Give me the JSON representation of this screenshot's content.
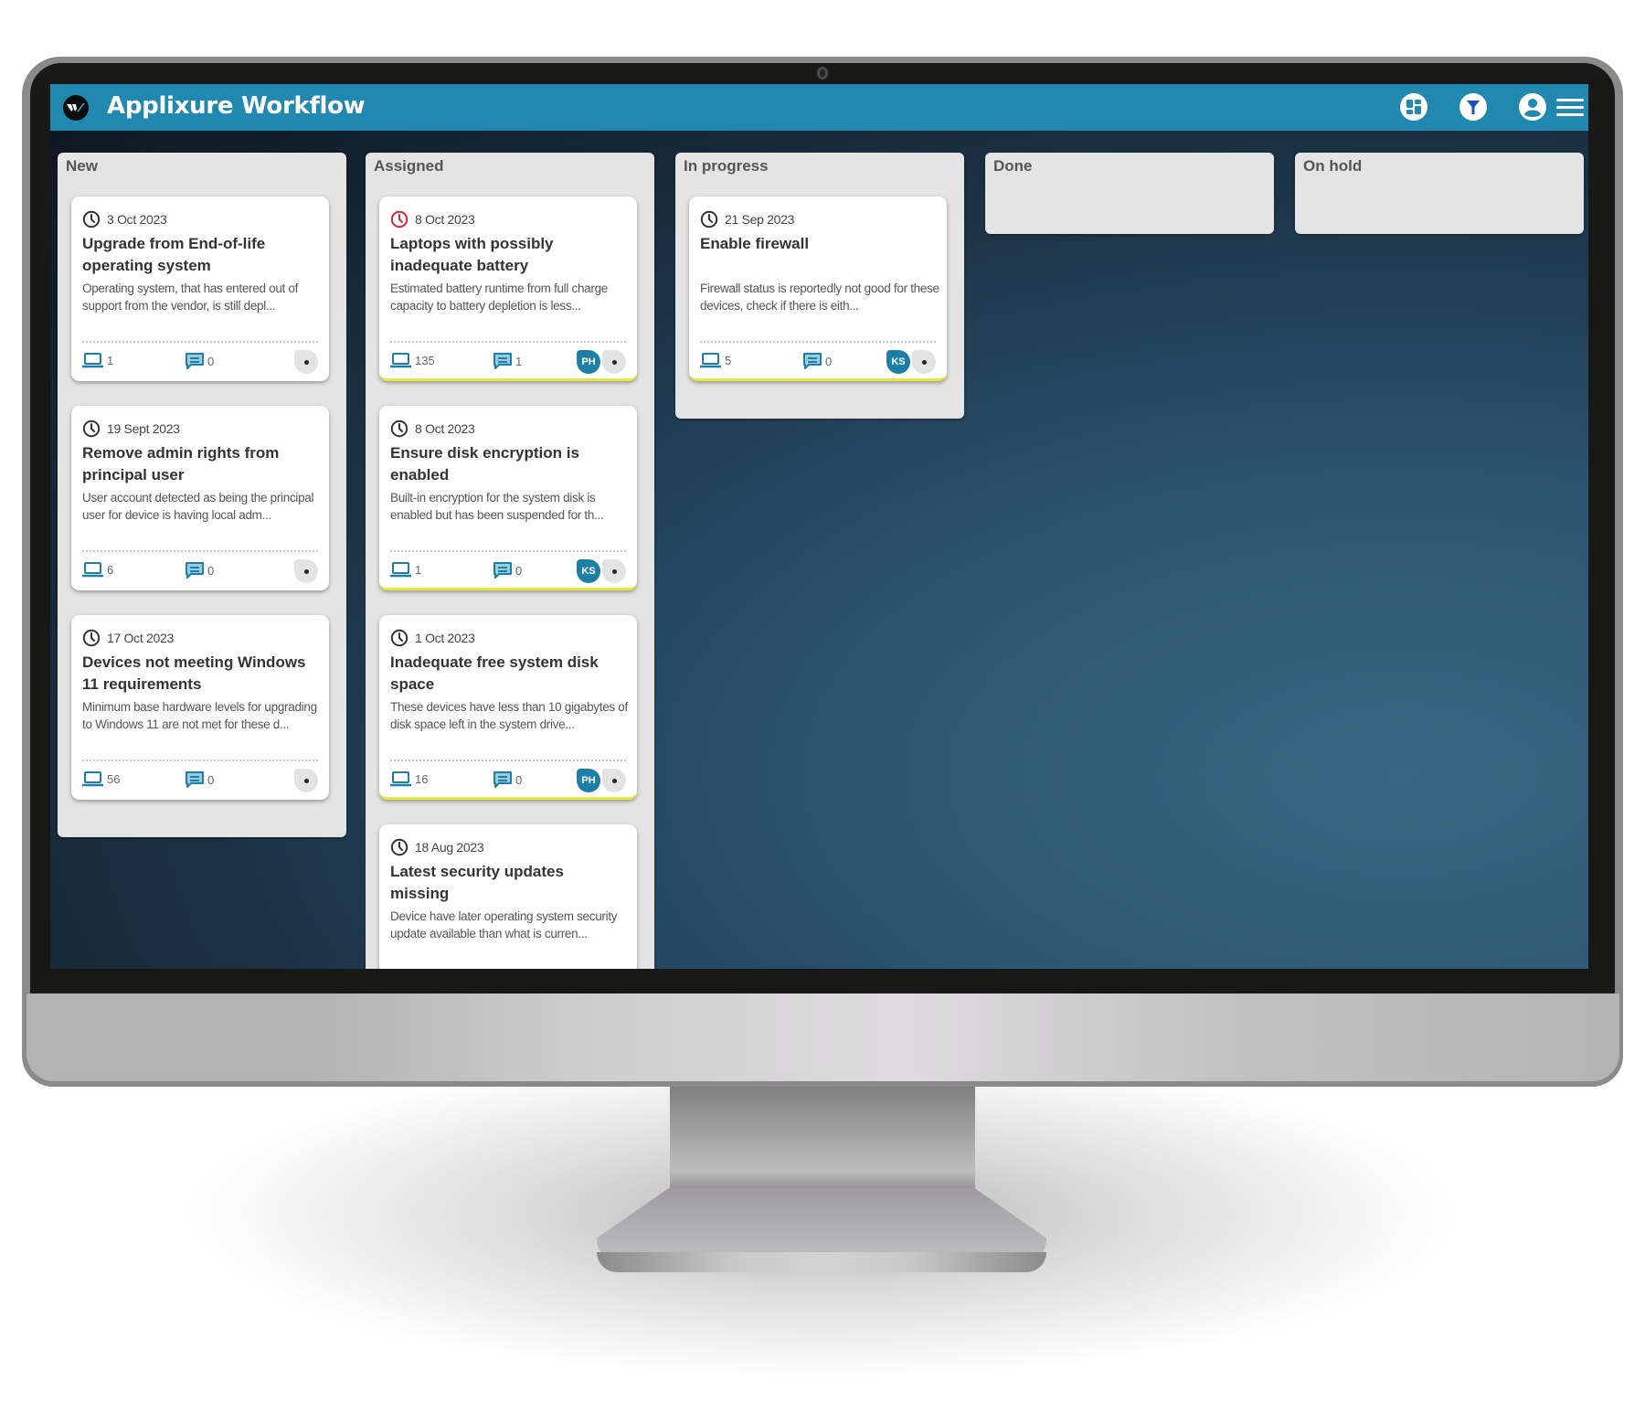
{
  "app": {
    "title": "Applixure Workflow",
    "brand_color": "#2188b0",
    "header_icons": [
      {
        "name": "dashboard-icon"
      },
      {
        "name": "filter-icon"
      },
      {
        "name": "user-account-icon"
      },
      {
        "name": "hamburger-menu-icon"
      }
    ]
  },
  "board": {
    "columns": [
      {
        "title": "New",
        "cards": [
          {
            "date": "3 Oct 2023",
            "overdue": false,
            "title": "Upgrade from End-of-life operating system",
            "description": "Operating system, that has entered out of support from the vendor, is still depl...",
            "devices": "1",
            "comments": "0",
            "assignee": ""
          },
          {
            "date": "19 Sept 2023",
            "overdue": false,
            "title": "Remove admin rights from principal user",
            "description": "User account detected as being the principal user for device is having local adm...",
            "devices": "6",
            "comments": "0",
            "assignee": ""
          },
          {
            "date": "17 Oct 2023",
            "overdue": false,
            "title": "Devices not meeting Windows 11 requirements",
            "description": "Minimum base hardware levels for upgrading to Windows 11 are not met for these d...",
            "devices": "56",
            "comments": "0",
            "assignee": ""
          }
        ]
      },
      {
        "title": "Assigned",
        "cards": [
          {
            "date": "8 Oct 2023",
            "overdue": true,
            "title": "Laptops with possibly inadequate battery",
            "description": "Estimated battery runtime from full charge capacity to battery depletion is less...",
            "devices": "135",
            "comments": "1",
            "assignee": "PH"
          },
          {
            "date": "8 Oct 2023",
            "overdue": false,
            "title": "Ensure disk encryption is enabled",
            "description": "Built-in encryption for the system disk is enabled but has been suspended for th...",
            "devices": "1",
            "comments": "0",
            "assignee": "KS"
          },
          {
            "date": "1 Oct 2023",
            "overdue": false,
            "title": "Inadequate free system disk space",
            "description": "These devices have less than 10 gigabytes of disk space left in the system drive...",
            "devices": "16",
            "comments": "0",
            "assignee": "PH"
          },
          {
            "date": "18 Aug 2023",
            "overdue": false,
            "title": "Latest security updates missing",
            "description": "Device have later operating system security update available than what is curren...",
            "devices": "",
            "comments": "",
            "assignee": ""
          }
        ]
      },
      {
        "title": "In progress",
        "cards": [
          {
            "date": "21 Sep 2023",
            "overdue": false,
            "title": "Enable firewall",
            "description": "Firewall status is reportedly not good for these devices, check if there is eith...",
            "devices": "5",
            "comments": "0",
            "assignee": "KS"
          }
        ]
      },
      {
        "title": "Done",
        "cards": []
      },
      {
        "title": "On hold",
        "cards": []
      }
    ]
  },
  "colors": {
    "overdue": "#d0233f",
    "normal_clock": "#333333",
    "accent": "#1d7ea8",
    "assigned_underline": "#e6e83a"
  }
}
